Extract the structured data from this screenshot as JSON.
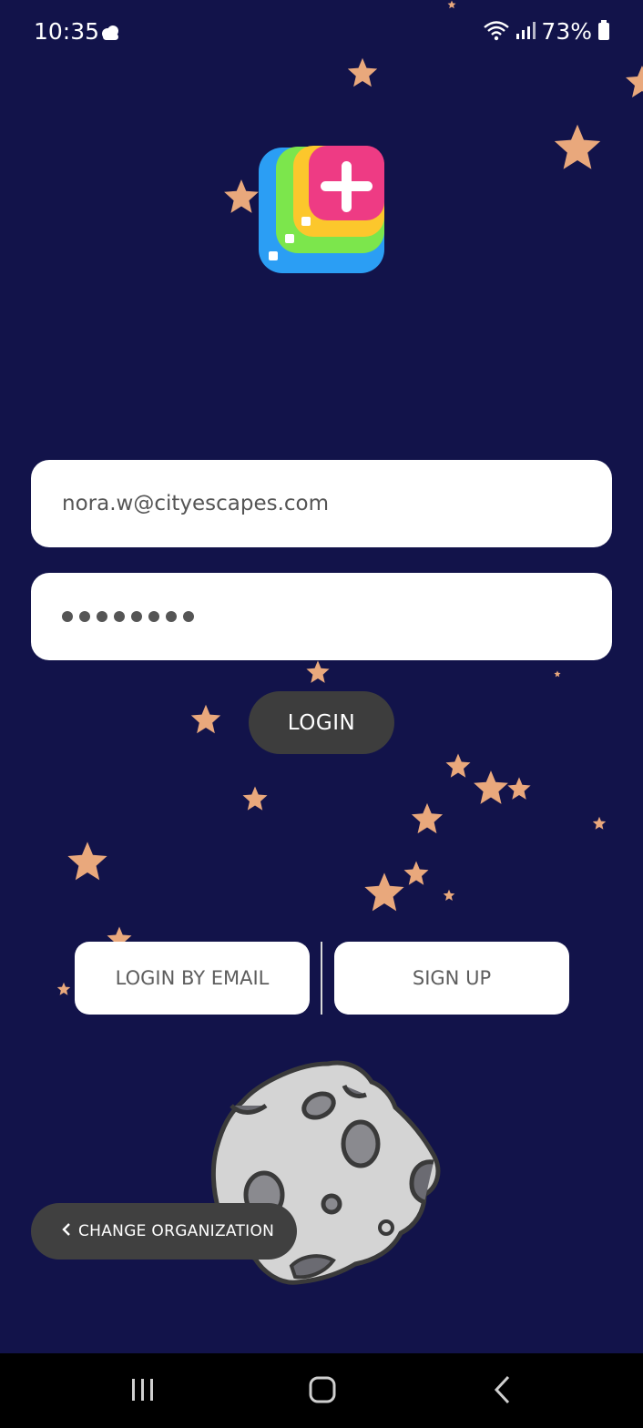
{
  "status_bar": {
    "time": "10:35",
    "battery": "73%",
    "icons": [
      "cloud-icon",
      "wifi-icon",
      "signal-icon",
      "battery-icon"
    ]
  },
  "login_form": {
    "email_value": "nora.w@cityescapes.com",
    "password_dots": 8,
    "login_label": "LOGIN"
  },
  "secondary_actions": {
    "login_by_email_label": "LOGIN BY EMAIL",
    "sign_up_label": "SIGN UP"
  },
  "change_organization_label": "CHANGE ORGANIZATION",
  "colors": {
    "background": "#12134a",
    "star": "#e9a87c",
    "dark_button": "#3d3d3d",
    "logo_pink": "#ee3b84",
    "logo_yellow": "#fcc72c",
    "logo_green": "#7ce64c",
    "logo_blue": "#2b9ef4"
  }
}
